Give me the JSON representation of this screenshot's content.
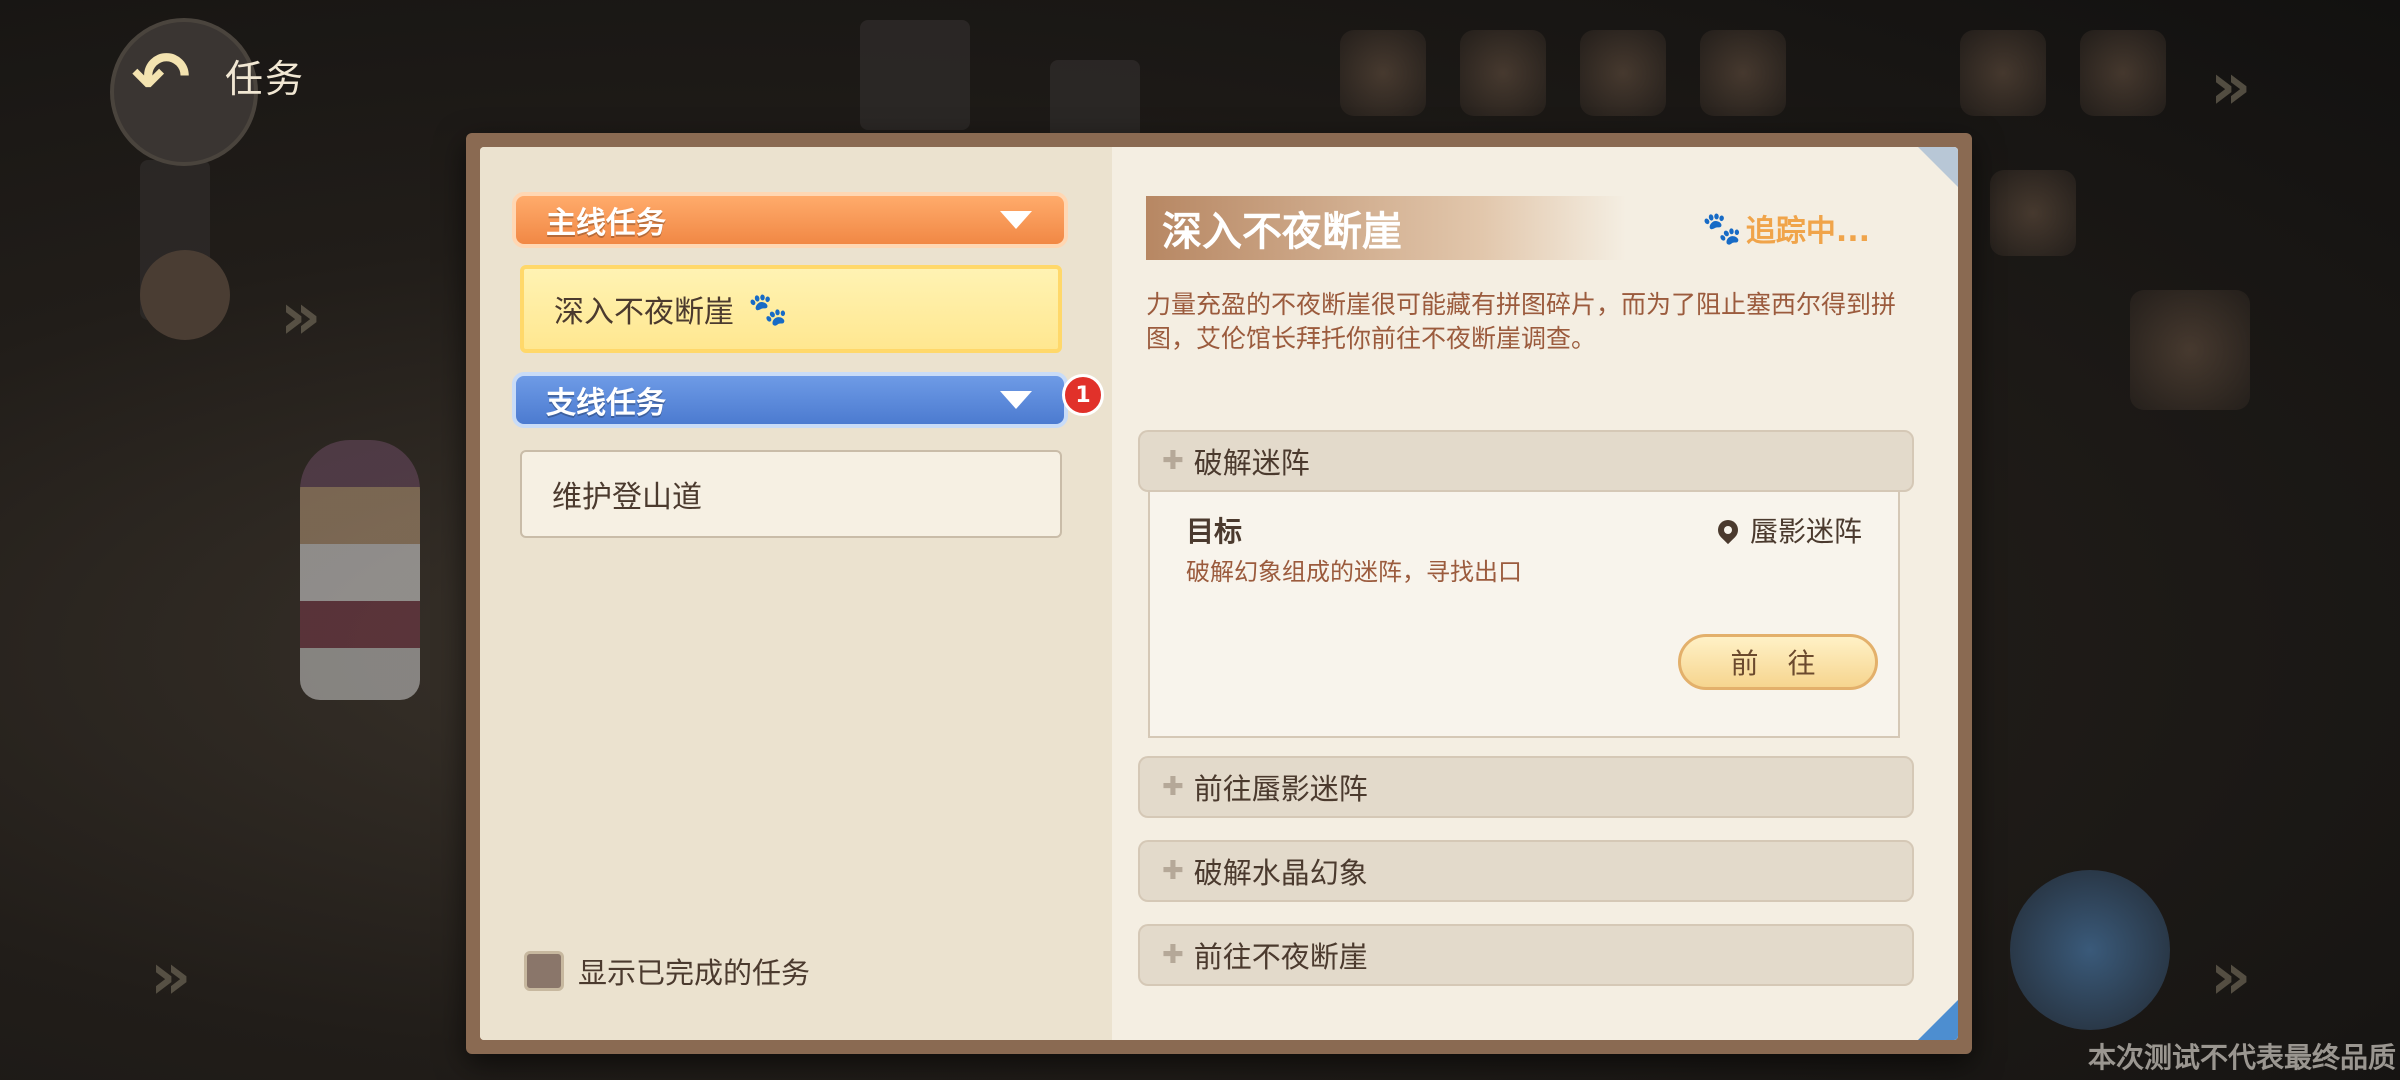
{
  "header": {
    "back_icon": "back-arrow-icon",
    "title": "任务"
  },
  "left": {
    "main_category": "主线任务",
    "main_tasks": [
      {
        "label": "深入不夜断崖",
        "icon": "paw-icon"
      }
    ],
    "side_category": "支线任务",
    "side_badge": "1",
    "side_tasks": [
      {
        "label": "维护登山道"
      }
    ],
    "show_completed_label": "显示已完成的任务"
  },
  "detail": {
    "title": "深入不夜断崖",
    "tracking_label": "追踪中...",
    "description": "力量充盈的不夜断崖很可能藏有拼图碎片，而为了阻止塞西尔得到拼图，艾伦馆长拜托你前往不夜断崖调查。",
    "steps": [
      {
        "name": "破解迷阵",
        "goal_label": "目标",
        "location": "蜃影迷阵",
        "goal_desc": "破解幻象组成的迷阵，寻找出口",
        "go_button": "前 往"
      },
      {
        "name": "前往蜃影迷阵"
      },
      {
        "name": "破解水晶幻象"
      },
      {
        "name": "前往不夜断崖"
      }
    ]
  },
  "watermark": "本次测试不代表最终品质",
  "colors": {
    "main_tab": "#f18845",
    "side_tab": "#4c7bd0",
    "accent_orange": "#f0a44a",
    "badge_red": "#e1312a"
  }
}
